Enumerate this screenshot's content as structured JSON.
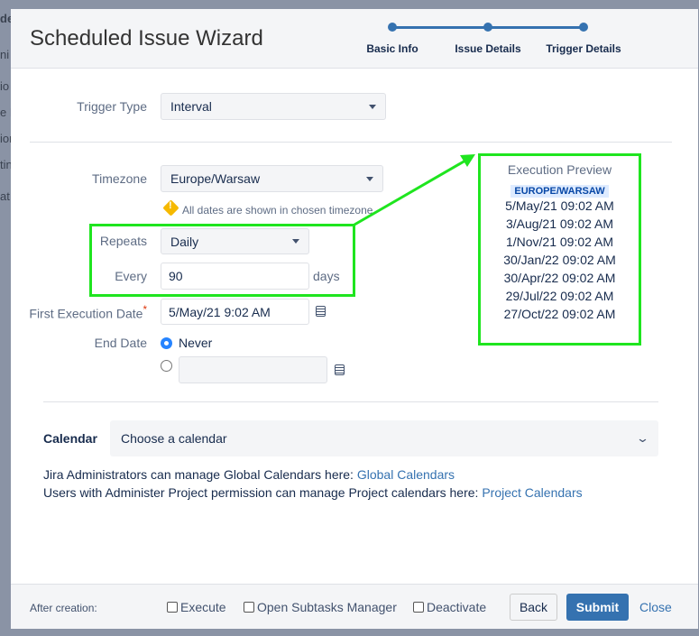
{
  "background": {
    "fragments": [
      "de",
      "ni",
      "io",
      "e F",
      "ion",
      "tin",
      "at"
    ]
  },
  "header": {
    "title": "Scheduled Issue Wizard",
    "steps": [
      "Basic Info",
      "Issue Details",
      "Trigger Details"
    ]
  },
  "form": {
    "trigger_type": {
      "label": "Trigger Type",
      "value": "Interval"
    },
    "timezone": {
      "label": "Timezone",
      "value": "Europe/Warsaw",
      "note": "All dates are shown in chosen timezone"
    },
    "repeats": {
      "label": "Repeats",
      "value": "Daily"
    },
    "every": {
      "label": "Every",
      "value": "90",
      "unit": "days"
    },
    "first_execution": {
      "label": "First Execution Date",
      "required": "*",
      "value": "5/May/21 9:02 AM"
    },
    "end_date": {
      "label": "End Date",
      "never_label": "Never",
      "date_value": ""
    },
    "calendar": {
      "label": "Calendar",
      "placeholder": "Choose a calendar"
    },
    "help": {
      "line1": "Jira Administrators can manage Global Calendars here:",
      "link1": "Global Calendars",
      "line2": "Users with Administer Project permission can manage Project calendars here:",
      "link2": "Project Calendars"
    }
  },
  "preview": {
    "title": "Execution Preview",
    "timezone_badge": "EUROPE/WARSAW",
    "dates": [
      "5/May/21 09:02 AM",
      "3/Aug/21 09:02 AM",
      "1/Nov/21 09:02 AM",
      "30/Jan/22 09:02 AM",
      "30/Apr/22 09:02 AM",
      "29/Jul/22 09:02 AM",
      "27/Oct/22 09:02 AM"
    ]
  },
  "footer": {
    "after_creation": "After creation:",
    "execute": "Execute",
    "open_subtasks": "Open Subtasks Manager",
    "deactivate": "Deactivate",
    "back": "Back",
    "submit": "Submit",
    "close": "Close"
  },
  "colors": {
    "accent": "#3572b0",
    "highlight": "#1fe51f"
  }
}
